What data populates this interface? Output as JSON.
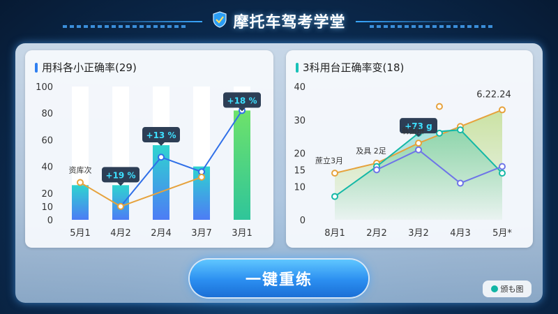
{
  "header": {
    "title": "摩托车驾考学堂",
    "logo_icon": "shield-logo-icon"
  },
  "panels": {
    "left": {
      "title": "用科各小正确率(29)",
      "accent": "#2f7ff0"
    },
    "right": {
      "title": "3科用台正确率变(18)",
      "accent": "#19c2b8"
    }
  },
  "button": {
    "label": "一键重练"
  },
  "badge": {
    "label": "颁も图"
  },
  "chart_data": [
    {
      "type": "bar",
      "title": "用科各小正确率(29)",
      "categories": [
        "5月1",
        "4月2",
        "2月4",
        "3月7",
        "3月1"
      ],
      "ylim": [
        0,
        100
      ],
      "yticks": [
        0,
        10,
        20,
        40,
        60,
        80,
        100
      ],
      "series": [
        {
          "kind": "bar",
          "values": [
            26,
            26,
            56,
            40,
            82
          ]
        },
        {
          "kind": "line",
          "color": "#2f6fe8",
          "values": [
            null,
            10,
            47,
            36,
            82
          ]
        },
        {
          "kind": "line",
          "color": "#e6a23c",
          "values": [
            28,
            10,
            null,
            32,
            null
          ]
        }
      ],
      "annotations": [
        {
          "text": "+19 %",
          "category": "4月2"
        },
        {
          "text": "+13 %",
          "category": "2月4"
        },
        {
          "text": "+18 %",
          "category": "3月1"
        },
        {
          "text": "资库次",
          "category": "5月1"
        }
      ]
    },
    {
      "type": "line",
      "title": "3科用台正确率变(18)",
      "categories": [
        "8月1",
        "2月2",
        "3月2",
        "4月3",
        "5月*"
      ],
      "ylim": [
        0,
        40
      ],
      "yticks": [
        0,
        10,
        15,
        20,
        30,
        40
      ],
      "series": [
        {
          "color": "#e6a23c",
          "values": [
            14,
            17,
            23,
            28,
            33
          ],
          "extra": {
            "x": 2.5,
            "y": 34
          }
        },
        {
          "color": "#14b8a6",
          "values": [
            7,
            16,
            26,
            27,
            14
          ],
          "extra": {
            "x": 2.5,
            "y": 26
          }
        },
        {
          "color": "#6e74e8",
          "values": [
            null,
            15,
            21,
            11,
            16
          ]
        }
      ],
      "annotations": [
        {
          "text": "+73 g",
          "category": "3月2"
        },
        {
          "text": "6.22.24",
          "category": "5月*"
        },
        {
          "text": "蔗立3月",
          "category": "8月1"
        },
        {
          "text": "及具 2足",
          "category": "2月2"
        },
        {
          "text": "翁面卅",
          "category": "3月2"
        }
      ]
    }
  ]
}
